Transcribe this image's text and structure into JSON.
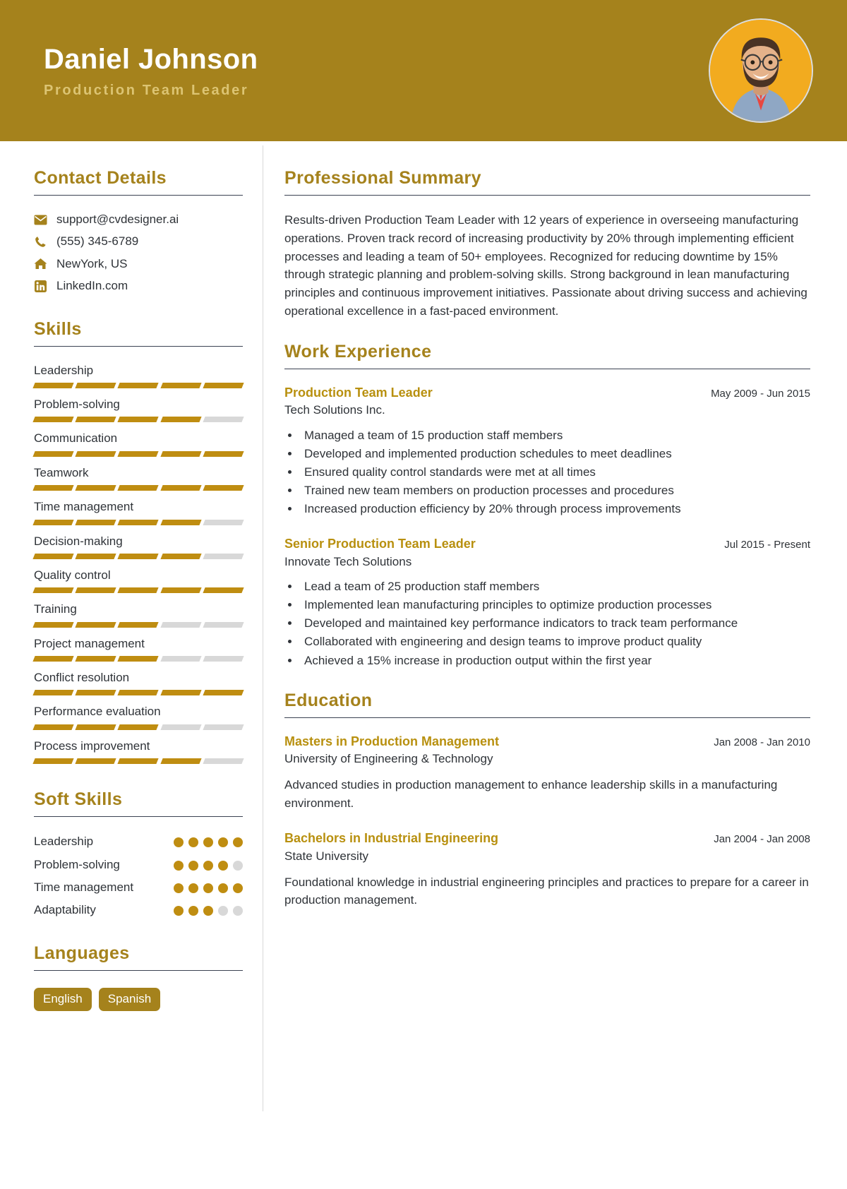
{
  "theme": {
    "header_bg": "#a5821c",
    "accent": "#a5821c",
    "accent_heading": "#b8900f",
    "subtitle": "#dcc473",
    "bar_fill": "#bf8d11",
    "bar_empty": "#d8d8d8",
    "text": "#2f3338",
    "rule": "#3b4252"
  },
  "header": {
    "name": "Daniel Johnson",
    "title": "Production Team Leader",
    "avatar_alt": "profile-photo"
  },
  "sidebar": {
    "contact": {
      "heading": "Contact Details",
      "items": [
        {
          "icon": "envelope-icon",
          "value": "support@cvdesigner.ai"
        },
        {
          "icon": "phone-icon",
          "value": "(555) 345-6789"
        },
        {
          "icon": "home-icon",
          "value": "NewYork, US"
        },
        {
          "icon": "linkedin-icon",
          "value": "LinkedIn.com"
        }
      ]
    },
    "skills": {
      "heading": "Skills",
      "max": 5,
      "items": [
        {
          "name": "Leadership",
          "level": 5
        },
        {
          "name": "Problem-solving",
          "level": 4
        },
        {
          "name": "Communication",
          "level": 5
        },
        {
          "name": "Teamwork",
          "level": 5
        },
        {
          "name": "Time management",
          "level": 4
        },
        {
          "name": "Decision-making",
          "level": 4
        },
        {
          "name": "Quality control",
          "level": 5
        },
        {
          "name": "Training",
          "level": 3
        },
        {
          "name": "Project management",
          "level": 3
        },
        {
          "name": "Conflict resolution",
          "level": 5
        },
        {
          "name": "Performance evaluation",
          "level": 3
        },
        {
          "name": "Process improvement",
          "level": 4
        }
      ]
    },
    "soft_skills": {
      "heading": "Soft Skills",
      "max": 5,
      "items": [
        {
          "name": "Leadership",
          "level": 5
        },
        {
          "name": "Problem-solving",
          "level": 4
        },
        {
          "name": "Time management",
          "level": 5
        },
        {
          "name": "Adaptability",
          "level": 3
        }
      ]
    },
    "languages": {
      "heading": "Languages",
      "items": [
        "English",
        "Spanish"
      ]
    }
  },
  "main": {
    "summary": {
      "heading": "Professional Summary",
      "text": "Results-driven Production Team Leader with 12 years of experience in overseeing manufacturing operations. Proven track record of increasing productivity by 20% through implementing efficient processes and leading a team of 50+ employees. Recognized for reducing downtime by 15% through strategic planning and problem-solving skills. Strong background in lean manufacturing principles and continuous improvement initiatives. Passionate about driving success and achieving operational excellence in a fast-paced environment."
    },
    "experience": {
      "heading": "Work Experience",
      "entries": [
        {
          "role": "Production Team Leader",
          "date": "May 2009 - Jun 2015",
          "org": "Tech Solutions Inc.",
          "bullets": [
            "Managed a team of 15 production staff members",
            "Developed and implemented production schedules to meet deadlines",
            "Ensured quality control standards were met at all times",
            "Trained new team members on production processes and procedures",
            "Increased production efficiency by 20% through process improvements"
          ]
        },
        {
          "role": "Senior Production Team Leader",
          "date": "Jul 2015 - Present",
          "org": "Innovate Tech Solutions",
          "bullets": [
            "Lead a team of 25 production staff members",
            "Implemented lean manufacturing principles to optimize production processes",
            "Developed and maintained key performance indicators to track team performance",
            "Collaborated with engineering and design teams to improve product quality",
            "Achieved a 15% increase in production output within the first year"
          ]
        }
      ]
    },
    "education": {
      "heading": "Education",
      "entries": [
        {
          "degree": "Masters in Production Management",
          "date": "Jan 2008 - Jan 2010",
          "school": "University of Engineering & Technology",
          "description": "Advanced studies in production management to enhance leadership skills in a manufacturing environment."
        },
        {
          "degree": "Bachelors in Industrial Engineering",
          "date": "Jan 2004 - Jan 2008",
          "school": "State University",
          "description": "Foundational knowledge in industrial engineering principles and practices to prepare for a career in production management."
        }
      ]
    }
  }
}
